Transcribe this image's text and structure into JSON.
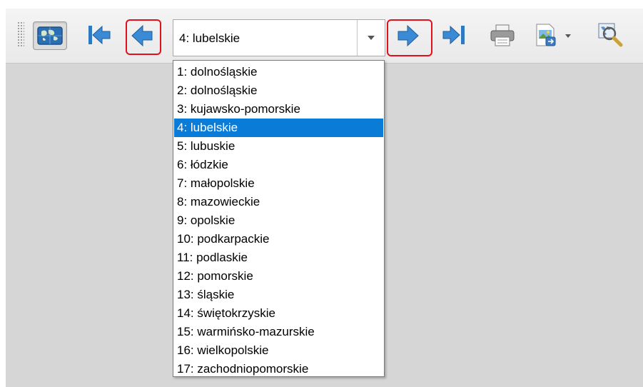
{
  "toolbar": {
    "buttons": [
      {
        "name": "atlas-preview-button",
        "icon": "map-icon",
        "pressed": true
      },
      {
        "name": "first-feature-button",
        "icon": "first-arrow-icon"
      },
      {
        "name": "previous-feature-button",
        "icon": "left-arrow-icon",
        "highlighted": true
      },
      {
        "name": "next-feature-button",
        "icon": "right-arrow-icon",
        "highlighted": true
      },
      {
        "name": "last-feature-button",
        "icon": "last-arrow-icon"
      },
      {
        "name": "print-atlas-button",
        "icon": "printer-icon"
      },
      {
        "name": "export-atlas-button",
        "icon": "image-export-icon"
      },
      {
        "name": "atlas-settings-button",
        "icon": "zoom-settings-icon"
      }
    ],
    "highlight_color": "#e0101f"
  },
  "feature_combo": {
    "selected": "4: lubelskie",
    "options": [
      "1: dolnośląskie",
      "2: dolnośląskie",
      "3: kujawsko-pomorskie",
      "4: lubelskie",
      "5: lubuskie",
      "6: łódzkie",
      "7: małopolskie",
      "8: mazowieckie",
      "9: opolskie",
      "10: podkarpackie",
      "11: podlaskie",
      "12: pomorskie",
      "13: śląskie",
      "14: świętokrzyskie",
      "15: warmińsko-mazurskie",
      "16: wielkopolskie",
      "17: zachodniopomorskie"
    ],
    "selected_index": 3,
    "selection_color": "#0a7bd7"
  }
}
